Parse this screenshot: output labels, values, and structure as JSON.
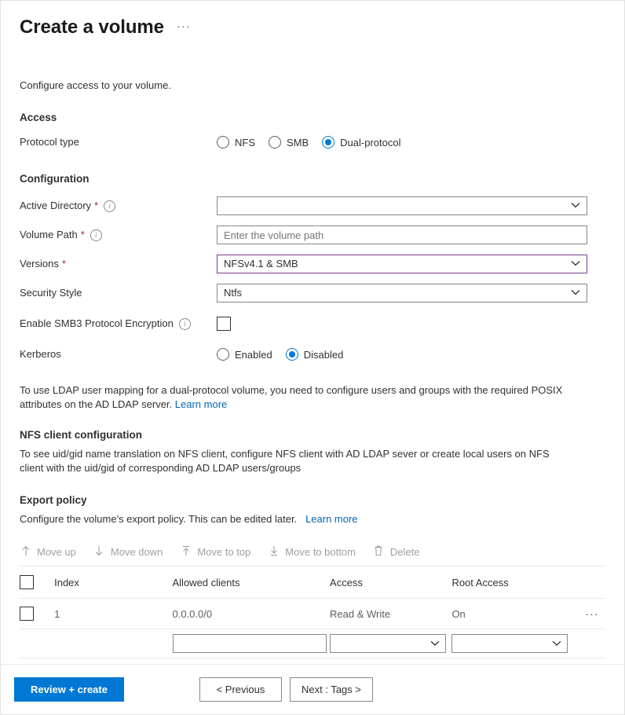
{
  "page": {
    "title": "Create a volume",
    "more_menu": "···",
    "intro": "Configure access to your volume."
  },
  "access": {
    "heading": "Access",
    "protocol_label": "Protocol type",
    "options": [
      {
        "label": "NFS",
        "checked": false
      },
      {
        "label": "SMB",
        "checked": false
      },
      {
        "label": "Dual-protocol",
        "checked": true
      }
    ]
  },
  "configuration": {
    "heading": "Configuration",
    "active_directory": {
      "label": "Active Directory",
      "required": "*",
      "value": "",
      "info": "i"
    },
    "volume_path": {
      "label": "Volume Path",
      "required": "*",
      "placeholder": "Enter the volume path",
      "value": "",
      "info": "i"
    },
    "versions": {
      "label": "Versions",
      "required": "*",
      "value": "NFSv4.1 & SMB",
      "accent_color": "#7a3b8f"
    },
    "security_style": {
      "label": "Security Style",
      "value": "Ntfs"
    },
    "smb3_encryption": {
      "label": "Enable SMB3 Protocol Encryption",
      "checked": false,
      "info": "i"
    },
    "kerberos": {
      "label": "Kerberos",
      "options": [
        {
          "label": "Enabled",
          "checked": false
        },
        {
          "label": "Disabled",
          "checked": true
        }
      ]
    }
  },
  "ldap_note": {
    "text": "To use LDAP user mapping for a dual-protocol volume, you need to configure users and groups with the required POSIX attributes on the AD LDAP server.",
    "link": "Learn more"
  },
  "nfs_client": {
    "heading": "NFS client configuration",
    "text": "To see uid/gid name translation on NFS client, configure NFS client with AD LDAP sever or create local users on NFS client with the uid/gid of corresponding AD LDAP users/groups"
  },
  "export_policy": {
    "heading": "Export policy",
    "text": "Configure the volume's export policy. This can be edited later.",
    "link": "Learn more",
    "commands": [
      {
        "label": "Move up",
        "icon": "↑",
        "icon_name": "arrow-up-icon",
        "disabled": true
      },
      {
        "label": "Move down",
        "icon": "↓",
        "icon_name": "arrow-down-icon",
        "disabled": true
      },
      {
        "label": "Move to top",
        "icon": "↥",
        "icon_name": "arrow-to-top-icon",
        "disabled": true
      },
      {
        "label": "Move to bottom",
        "icon": "↧",
        "icon_name": "arrow-to-bottom-icon",
        "disabled": true
      },
      {
        "label": "Delete",
        "icon": "Ὕ1",
        "icon_name": "trash-icon",
        "disabled": true
      }
    ],
    "table": {
      "columns": [
        "Index",
        "Allowed clients",
        "Access",
        "Root Access"
      ],
      "rows": [
        {
          "checked": false,
          "index": "1",
          "allowed_clients": "0.0.0.0/0",
          "access": "Read & Write",
          "root_access": "On",
          "row_menu": "···"
        }
      ],
      "editor_row": {
        "allowed_clients_value": "",
        "access_value": "",
        "root_access_value": ""
      }
    }
  },
  "footer": {
    "primary": "Review + create",
    "previous": "< Previous",
    "next": "Next : Tags >",
    "accent_color": "#0078d4"
  }
}
